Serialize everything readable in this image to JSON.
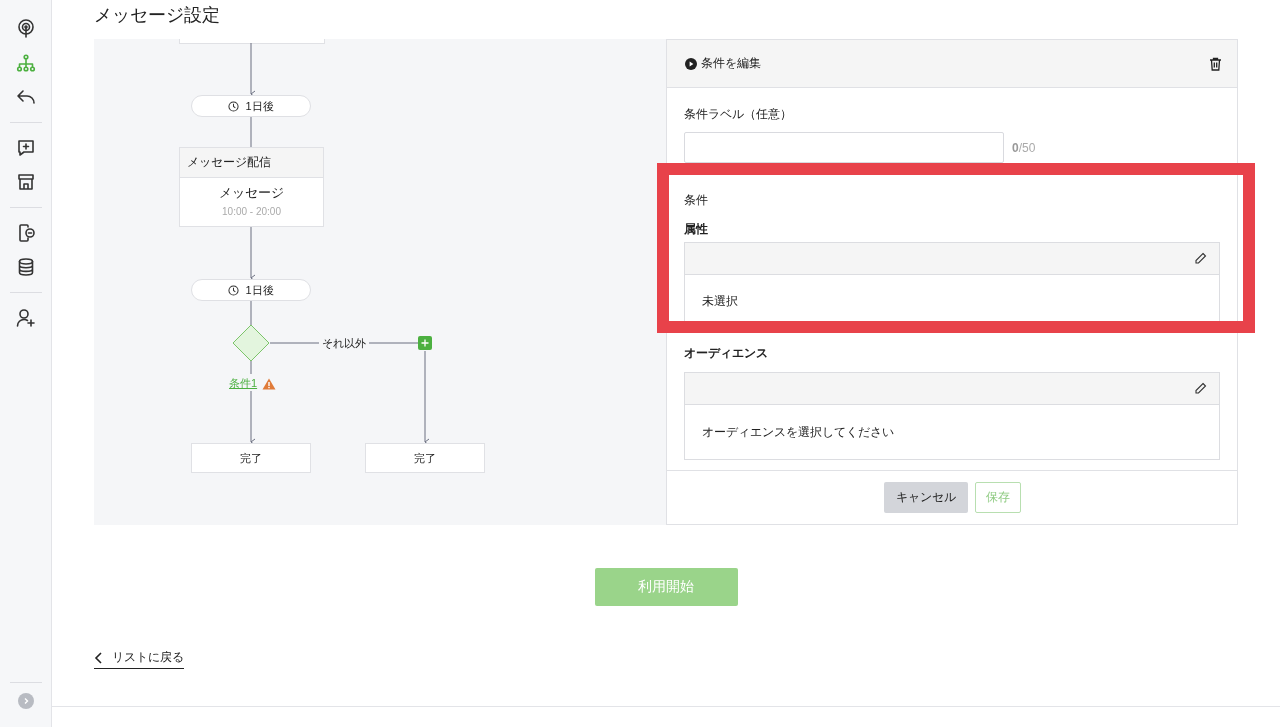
{
  "sidebar": {
    "groups": [
      [
        {
          "kind": "broadcast",
          "selected": false
        },
        {
          "kind": "hierarchy",
          "selected": true
        },
        {
          "kind": "reply",
          "selected": false
        }
      ],
      [
        {
          "kind": "add-message",
          "selected": false
        },
        {
          "kind": "shop",
          "selected": false
        }
      ],
      [
        {
          "kind": "phone-chat",
          "selected": false
        },
        {
          "kind": "database",
          "selected": false
        }
      ],
      [
        {
          "kind": "add-user",
          "selected": false
        }
      ]
    ]
  },
  "page": {
    "title": "メッセージ設定"
  },
  "flow": {
    "delays": [
      "1日後",
      "1日後"
    ],
    "message_card": {
      "header": "メッセージ配信",
      "title": "メッセージ",
      "time": "10:00 - 20:00"
    },
    "branch": {
      "condition_link": "条件1",
      "warning": true,
      "else_label": "それ以外"
    },
    "end_nodes": [
      "完了",
      "完了"
    ]
  },
  "editor": {
    "title": "条件を編集",
    "label_field": {
      "label": "条件ラベル（任意）",
      "counter": "**0**/50"
    },
    "condition_heading": "条件",
    "attribute": {
      "heading": "属性",
      "value": "未選択"
    },
    "audience": {
      "heading": "オーディエンス",
      "value": "オーディエンスを選択してください"
    },
    "cancel_button": "キャンセル",
    "save_button": {
      "label": "保存",
      "disabled": true
    }
  },
  "start_button": "利用開始",
  "back_link": "リストに戻る"
}
